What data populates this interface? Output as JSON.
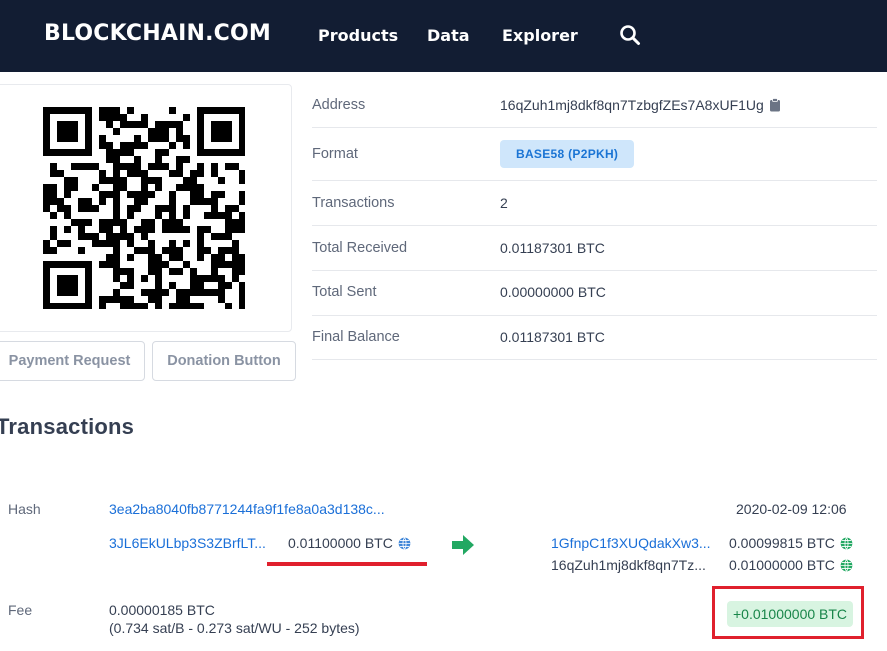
{
  "header": {
    "logo": "BLOCKCHAIN.COM",
    "nav": [
      "Products",
      "Data",
      "Explorer"
    ],
    "search_icon": "search-icon"
  },
  "actions": {
    "payment_request": "Payment Request",
    "donation_button": "Donation Button"
  },
  "info": {
    "address_label": "Address",
    "address_value": "16qZuh1mj8dkf8qn7TzbgfZEs7A8xUF1Ug",
    "format_label": "Format",
    "format_value": "BASE58 (P2PKH)",
    "transactions_label": "Transactions",
    "transactions_value": "2",
    "total_received_label": "Total Received",
    "total_received_value": "0.01187301 BTC",
    "total_sent_label": "Total Sent",
    "total_sent_value": "0.00000000 BTC",
    "final_balance_label": "Final Balance",
    "final_balance_value": "0.01187301 BTC"
  },
  "transactions": {
    "heading": "Transactions",
    "hash_label": "Hash",
    "hash_value": "3ea2ba8040fb8771244fa9f1fe8a0a3d138c...",
    "timestamp": "2020-02-09 12:06",
    "inputs": [
      {
        "address": "3JL6EkULbp3S3ZBrfLT...",
        "amount": "0.01100000 BTC"
      }
    ],
    "outputs": [
      {
        "address": "1GfnpC1f3XUQdakXw3...",
        "amount": "0.00099815 BTC",
        "is_link": true
      },
      {
        "address": "16qZuh1mj8dkf8qn7Tz...",
        "amount": "0.01000000 BTC",
        "is_link": false
      }
    ],
    "fee_label": "Fee",
    "fee_value": "0.00000185 BTC",
    "fee_detail": "(0.734 sat/B - 0.273 sat/WU - 252 bytes)",
    "result": "+0.01000000 BTC"
  },
  "colors": {
    "header_bg": "#121d33",
    "link": "#1a6fd8",
    "highlight": "#e0202d",
    "positive_bg": "#d8f4e1",
    "positive_text": "#19864a",
    "arrow": "#22a862"
  }
}
